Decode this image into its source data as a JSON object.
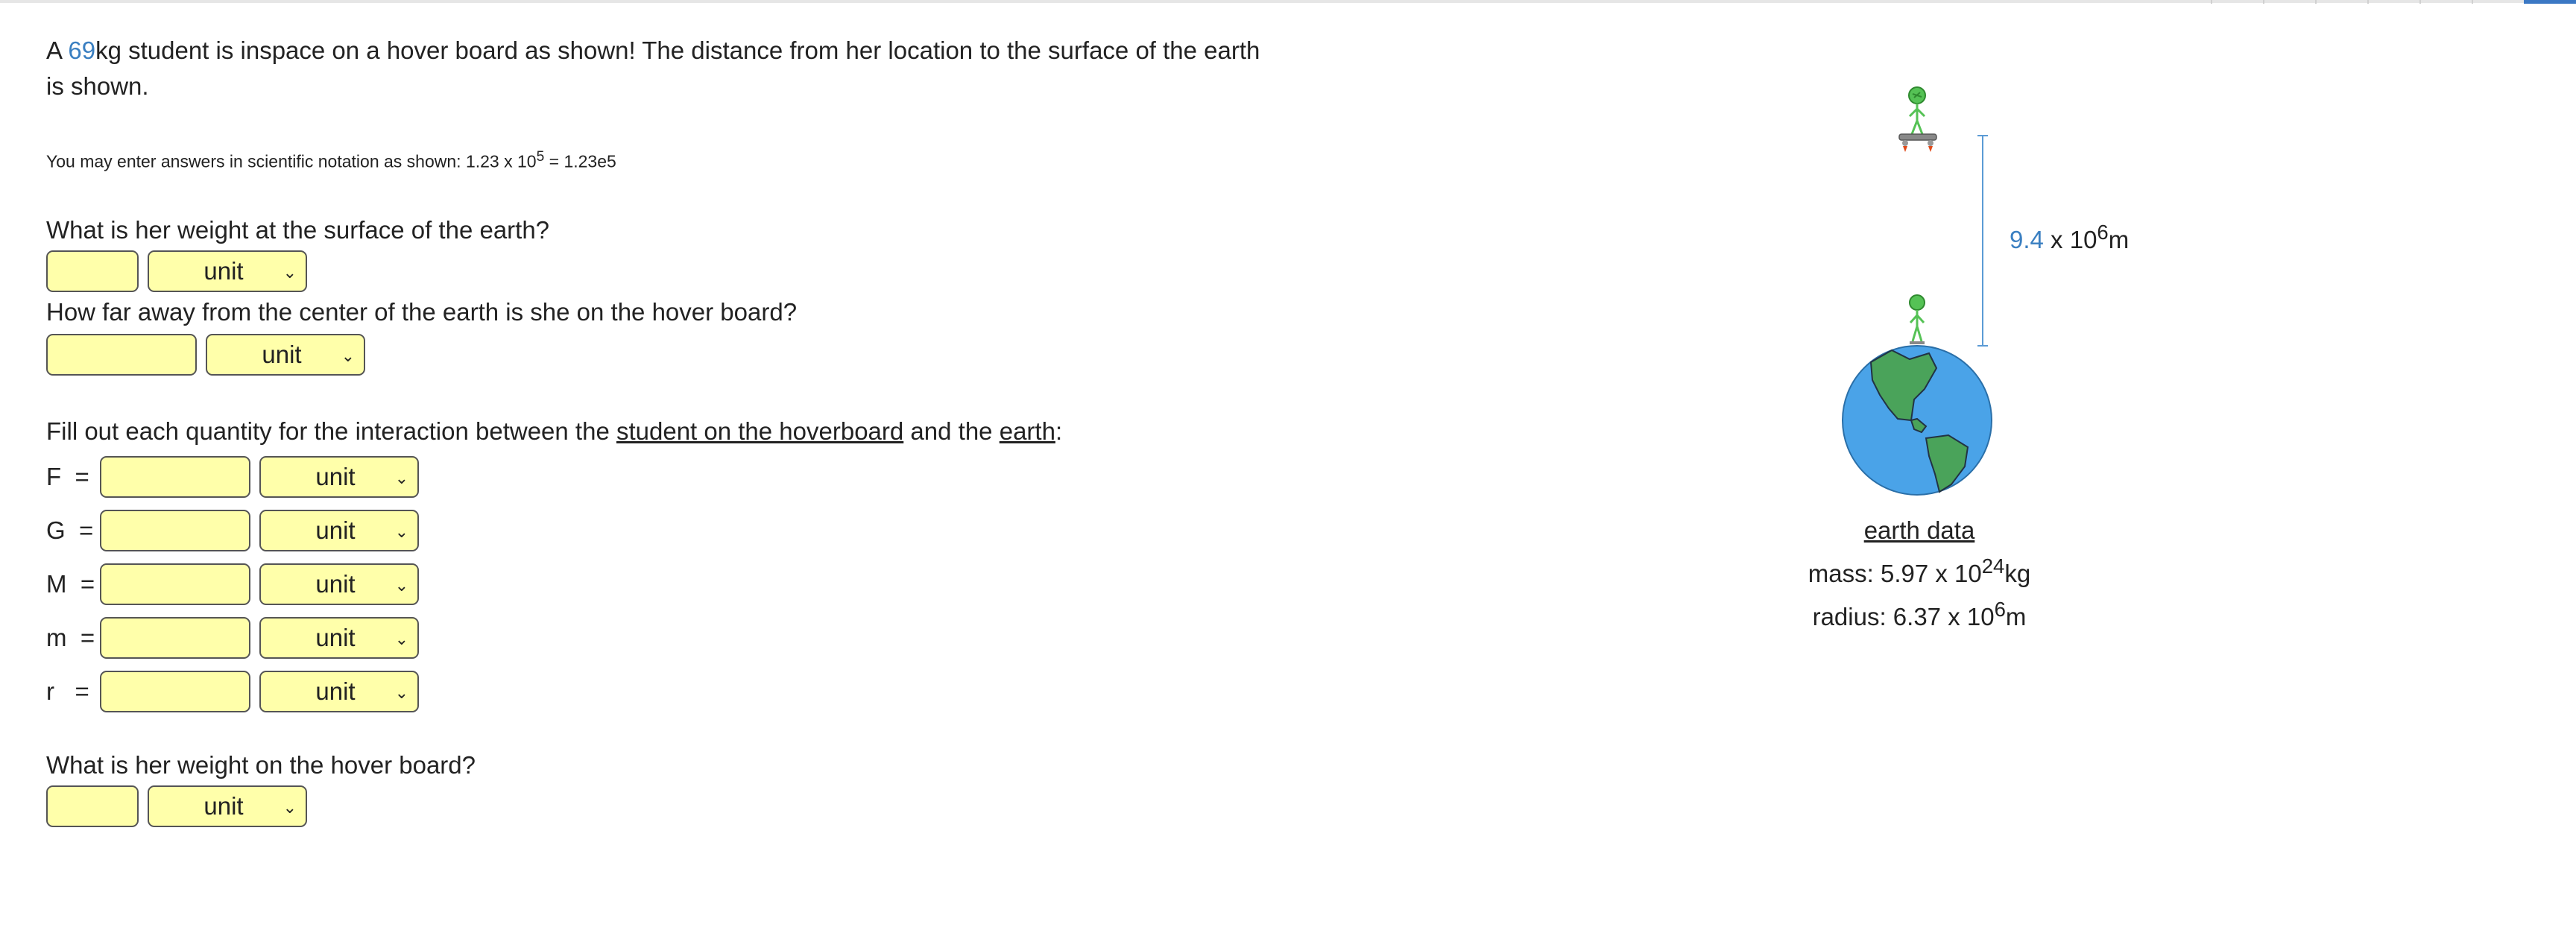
{
  "problem": {
    "intro_before": "A ",
    "mass_value": "69",
    "intro_after": "kg student is inspace on a hover board as shown! The distance from her location to the surface of the earth is shown."
  },
  "sci_note": {
    "prefix": "You may enter answers in scientific notation as shown: 1.23 x 10",
    "exp": "5",
    "suffix": " = 1.23e5"
  },
  "q1": {
    "text": "What is her weight at the surface of the earth?",
    "unit_label": "unit"
  },
  "q2": {
    "text": "How far away from the center of the earth is she on the hover board?",
    "unit_label": "unit"
  },
  "q3": {
    "text_a": "Fill out each quantity for the interaction between the ",
    "link_1": "student on the hoverboard",
    "text_b": " and the ",
    "link_2": "earth",
    "text_c": ":",
    "vars": [
      "F",
      "G",
      "M",
      "m",
      "r"
    ],
    "equals": "=",
    "unit_label": "unit"
  },
  "q4": {
    "text": "What is her weight on the hover board?",
    "unit_label": "unit"
  },
  "diagram": {
    "distance_coef": "9.4",
    "distance_base": " x 10",
    "distance_exp": "6",
    "distance_unit": "m"
  },
  "earth_data": {
    "title": "earth data",
    "mass_prefix": "mass: 5.97 x 10",
    "mass_exp": "24",
    "mass_unit": "kg",
    "radius_prefix": "radius: 6.37 x 10",
    "radius_exp": "6",
    "radius_unit": "m"
  },
  "colors": {
    "input_bg": "#ffffaa",
    "accent": "#3a7fc1",
    "earth_ocean": "#4aa3e8",
    "earth_land": "#4aa35a",
    "figure": "#55c255"
  }
}
